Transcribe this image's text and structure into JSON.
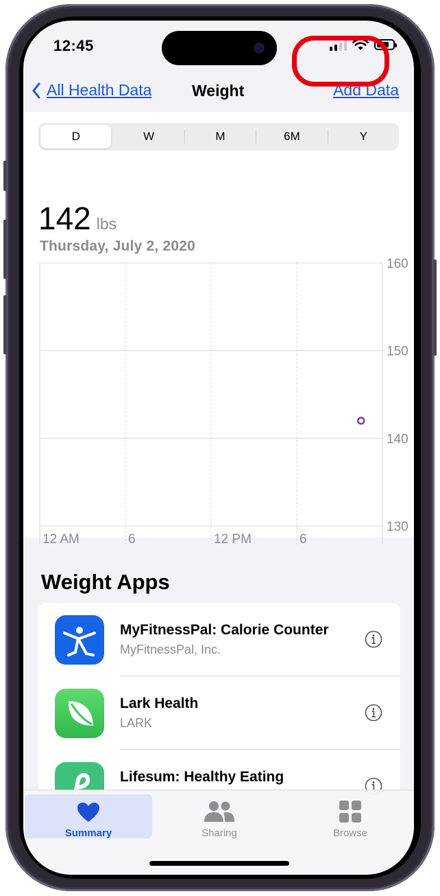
{
  "status": {
    "time": "12:45"
  },
  "nav": {
    "back_label": "All Health Data",
    "title": "Weight",
    "action_label": "Add Data"
  },
  "segments": [
    {
      "label": "D",
      "active": true
    },
    {
      "label": "W",
      "active": false
    },
    {
      "label": "M",
      "active": false
    },
    {
      "label": "6M",
      "active": false
    },
    {
      "label": "Y",
      "active": false
    }
  ],
  "reading": {
    "value": "142",
    "unit": "lbs",
    "date": "Thursday, July 2, 2020"
  },
  "chart_data": {
    "type": "scatter",
    "x_ticks": [
      "12 AM",
      "6",
      "12 PM",
      "6"
    ],
    "y_ticks": [
      "160",
      "150",
      "140",
      "130"
    ],
    "ylim": [
      130,
      160
    ],
    "xlim_hours": [
      0,
      24
    ],
    "points": [
      {
        "hour": 22.5,
        "value": 142
      }
    ],
    "grid": true,
    "point_color": "#7b3aa0"
  },
  "apps": {
    "header": "Weight Apps",
    "items": [
      {
        "name": "MyFitnessPal: Calorie Counter",
        "developer": "MyFitnessPal, Inc.",
        "icon": "myfitnesspal-icon",
        "color": "#1565e6"
      },
      {
        "name": "Lark Health",
        "developer": "LARK",
        "icon": "lark-leaf-icon",
        "color": "#3dc859"
      },
      {
        "name": "Lifesum: Healthy Eating",
        "developer": "",
        "icon": "lifesum-icon",
        "color": "#3fc07b"
      }
    ]
  },
  "tabbar": {
    "items": [
      {
        "label": "Summary",
        "icon": "heart-icon",
        "active": true
      },
      {
        "label": "Sharing",
        "icon": "people-icon",
        "active": false
      },
      {
        "label": "Browse",
        "icon": "grid-icon",
        "active": false
      }
    ]
  },
  "colors": {
    "accent": "#1a59d6",
    "annotation": "#e3000f"
  }
}
